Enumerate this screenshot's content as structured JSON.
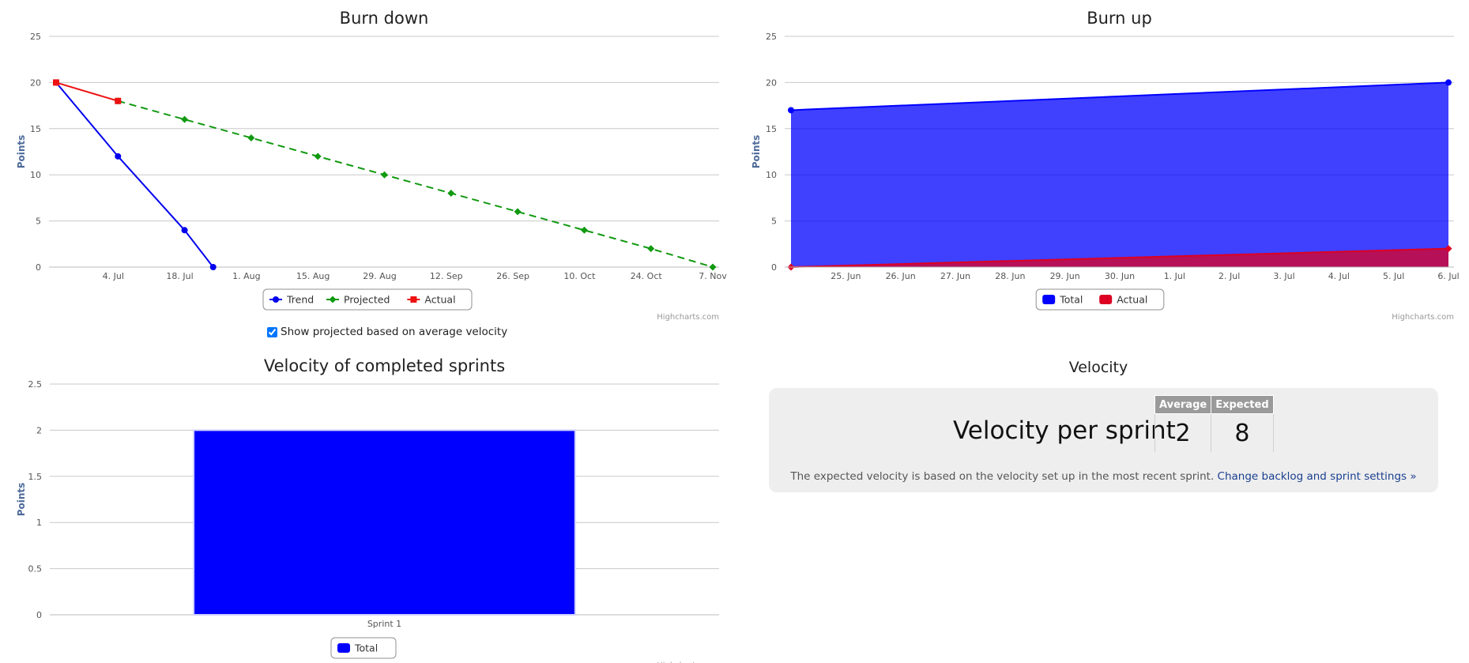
{
  "colors": {
    "trend": "#0000ee",
    "projected": "#119911",
    "actual": "#ee1111",
    "total_area": "#0000ff",
    "actual_area": "#dd0022",
    "grid": "#c8c8c8",
    "axis_text": "#555555"
  },
  "credits": "Highcharts.com",
  "burndown_checkbox": {
    "label": "Show projected based on average velocity",
    "checked": true
  },
  "chart_data": [
    {
      "id": "burndown",
      "type": "line",
      "title": "Burn down",
      "ylabel": "Points",
      "ylim": [
        0,
        25
      ],
      "yticks": [
        0,
        5,
        10,
        15,
        20,
        25
      ],
      "xrange": [
        "2014-06-22",
        "2014-11-07"
      ],
      "xticks": [
        {
          "date": "2014-07-04",
          "label": "4. Jul"
        },
        {
          "date": "2014-07-18",
          "label": "18. Jul"
        },
        {
          "date": "2014-08-01",
          "label": "1. Aug"
        },
        {
          "date": "2014-08-15",
          "label": "15. Aug"
        },
        {
          "date": "2014-08-29",
          "label": "29. Aug"
        },
        {
          "date": "2014-09-12",
          "label": "12. Sep"
        },
        {
          "date": "2014-09-26",
          "label": "26. Sep"
        },
        {
          "date": "2014-10-10",
          "label": "10. Oct"
        },
        {
          "date": "2014-10-24",
          "label": "24. Oct"
        },
        {
          "date": "2014-11-07",
          "label": "7. Nov"
        }
      ],
      "series": [
        {
          "name": "Trend",
          "color": "#0000ee",
          "dash": false,
          "marker": "circle",
          "points": [
            [
              "2014-06-22",
              20
            ],
            [
              "2014-07-05",
              12
            ],
            [
              "2014-07-19",
              4
            ],
            [
              "2014-07-25",
              0
            ]
          ]
        },
        {
          "name": "Projected",
          "color": "#119911",
          "dash": true,
          "marker": "diamond",
          "points": [
            [
              "2014-07-05",
              18
            ],
            [
              "2014-07-19",
              16
            ],
            [
              "2014-08-02",
              14
            ],
            [
              "2014-08-16",
              12
            ],
            [
              "2014-08-30",
              10
            ],
            [
              "2014-09-13",
              8
            ],
            [
              "2014-09-27",
              6
            ],
            [
              "2014-10-11",
              4
            ],
            [
              "2014-10-25",
              2
            ],
            [
              "2014-11-07",
              0
            ]
          ]
        },
        {
          "name": "Actual",
          "color": "#ee1111",
          "dash": false,
          "marker": "square",
          "points": [
            [
              "2014-06-22",
              20
            ],
            [
              "2014-07-05",
              18
            ]
          ]
        }
      ],
      "legend": "bottom-center"
    },
    {
      "id": "burnup",
      "type": "area",
      "title": "Burn up",
      "ylabel": "Points",
      "ylim": [
        0,
        25
      ],
      "yticks": [
        0,
        5,
        10,
        15,
        20,
        25
      ],
      "xrange": [
        "2014-06-24",
        "2014-07-06"
      ],
      "xticks": [
        {
          "date": "2014-06-25",
          "label": "25. Jun"
        },
        {
          "date": "2014-06-26",
          "label": "26. Jun"
        },
        {
          "date": "2014-06-27",
          "label": "27. Jun"
        },
        {
          "date": "2014-06-28",
          "label": "28. Jun"
        },
        {
          "date": "2014-06-29",
          "label": "29. Jun"
        },
        {
          "date": "2014-06-30",
          "label": "30. Jun"
        },
        {
          "date": "2014-07-01",
          "label": "1. Jul"
        },
        {
          "date": "2014-07-02",
          "label": "2. Jul"
        },
        {
          "date": "2014-07-03",
          "label": "3. Jul"
        },
        {
          "date": "2014-07-04",
          "label": "4. Jul"
        },
        {
          "date": "2014-07-05",
          "label": "5. Jul"
        },
        {
          "date": "2014-07-06",
          "label": "6. Jul"
        }
      ],
      "series": [
        {
          "name": "Total",
          "color": "#0000ff",
          "marker": "circle",
          "points": [
            [
              "2014-06-24",
              17
            ],
            [
              "2014-07-06",
              20
            ]
          ]
        },
        {
          "name": "Actual",
          "color": "#dd0022",
          "marker": "diamond",
          "points": [
            [
              "2014-06-24",
              0
            ],
            [
              "2014-07-06",
              2
            ]
          ]
        }
      ],
      "legend": "bottom-center"
    },
    {
      "id": "velocity",
      "type": "bar",
      "title": "Velocity of completed sprints",
      "ylabel": "Points",
      "ylim": [
        0,
        2.5
      ],
      "yticks": [
        0,
        0.5,
        1,
        1.5,
        2,
        2.5
      ],
      "categories": [
        "Sprint 1"
      ],
      "series": [
        {
          "name": "Total",
          "color": "#0000ff",
          "values": [
            2
          ]
        }
      ],
      "legend": "bottom-center"
    }
  ],
  "velocity_panel": {
    "title": "Velocity",
    "label": "Velocity per sprint",
    "average_header": "Average",
    "expected_header": "Expected",
    "average_value": "2",
    "expected_value": "8",
    "note": "The expected velocity is based on the velocity set up in the most recent sprint.",
    "link": "Change backlog and sprint settings »"
  }
}
